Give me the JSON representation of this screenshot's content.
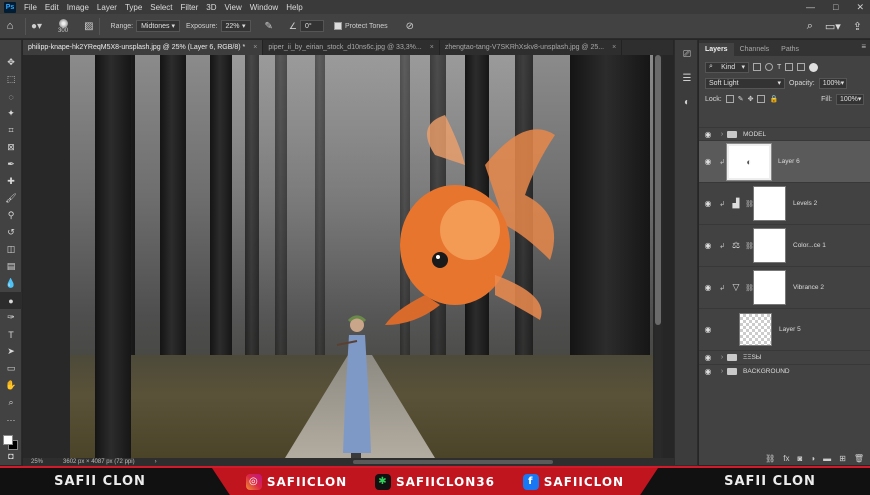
{
  "menu": [
    "File",
    "Edit",
    "Image",
    "Layer",
    "Type",
    "Select",
    "Filter",
    "3D",
    "View",
    "Window",
    "Help"
  ],
  "options": {
    "brush_size": "300",
    "range_label": "Range:",
    "range_value": "Midtones",
    "exposure_label": "Exposure:",
    "exposure_value": "22%",
    "angle_value": "0°",
    "protect_tones_label": "Protect Tones"
  },
  "tabs": [
    {
      "label": "philipp-knape-hk2YReqM5X8-unsplash.jpg @ 25% (Layer 6, RGB/8) *",
      "close": "×"
    },
    {
      "label": "piper_ii_by_eirian_stock_d10ns6c.jpg @ 33,3%...",
      "close": "×"
    },
    {
      "label": "zhengtao-tang-V7SKRhXskv8-unsplash.jpg @ 25...",
      "close": "×"
    }
  ],
  "status": {
    "zoom": "25%",
    "doc_info": "3602 px × 4087 px (72 ppi)"
  },
  "panel": {
    "tabs": [
      "Layers",
      "Channels",
      "Paths"
    ],
    "filter_kind": "Kind",
    "blend_mode": "Soft Light",
    "opacity_label": "Opacity:",
    "opacity_value": "100%",
    "lock_label": "Lock:",
    "fill_label": "Fill:",
    "fill_value": "100%"
  },
  "layers": [
    {
      "name": "MODEL",
      "type": "group"
    },
    {
      "name": "Layer 6",
      "type": "fish",
      "selected": true
    },
    {
      "name": "Levels 2",
      "type": "adjustment",
      "icon": "levels-icon"
    },
    {
      "name": "Color...ce 1",
      "type": "adjustment",
      "icon": "color-balance-icon"
    },
    {
      "name": "Vibrance 2",
      "type": "adjustment",
      "icon": "vibrance-icon"
    },
    {
      "name": "Layer 5",
      "type": "pixel"
    },
    {
      "name": "ΞΞSЫ",
      "type": "group"
    },
    {
      "name": "BACKGROUND",
      "type": "group"
    }
  ],
  "banner": {
    "left_name": "SAFII CLON",
    "right_name": "SAFII CLON",
    "instagram": "SAFIICLON",
    "other": "SAFIICLON36",
    "facebook": "SAFIICLON"
  },
  "colors": {
    "banner_red": "#c0141f",
    "panel_bg": "#424242",
    "menubar_bg": "#3a3a3a"
  }
}
